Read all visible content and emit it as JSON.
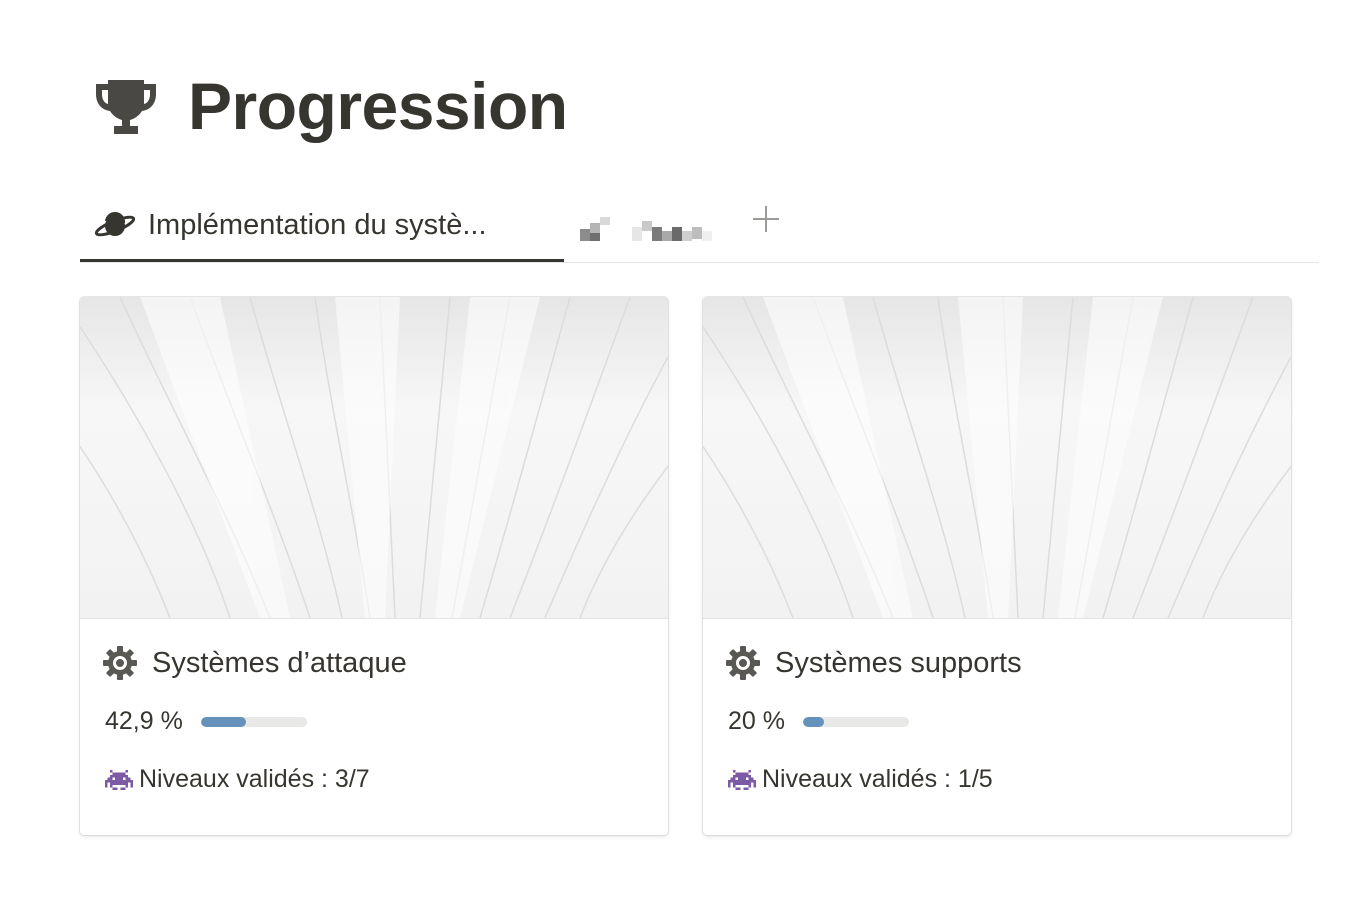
{
  "page": {
    "title": "Progression",
    "icon": "trophy-icon"
  },
  "tabs": {
    "active": {
      "label": "Implémentation du systè...",
      "icon": "ringed-planet-icon"
    },
    "second": {
      "label_redacted": true
    },
    "add_icon": "plus-icon",
    "add_label": "+"
  },
  "cards": [
    {
      "title": "Systèmes d’attaque",
      "icon": "gear-icon",
      "progress_text": "42,9 %",
      "progress_fraction": 0.429,
      "levels_icon": "alien-monster-icon",
      "levels_text": "Niveaux validés : 3/7"
    },
    {
      "title": "Systèmes supports",
      "icon": "gear-icon",
      "progress_text": "20 %",
      "progress_fraction": 0.2,
      "levels_icon": "alien-monster-icon",
      "levels_text": "Niveaux validés : 1/5"
    }
  ],
  "colors": {
    "text": "#37352f",
    "progress_fill": "#6592bb",
    "progress_track": "#e8e8e6",
    "tab_underline": "#37352f",
    "invader": "#7d5aa6"
  }
}
